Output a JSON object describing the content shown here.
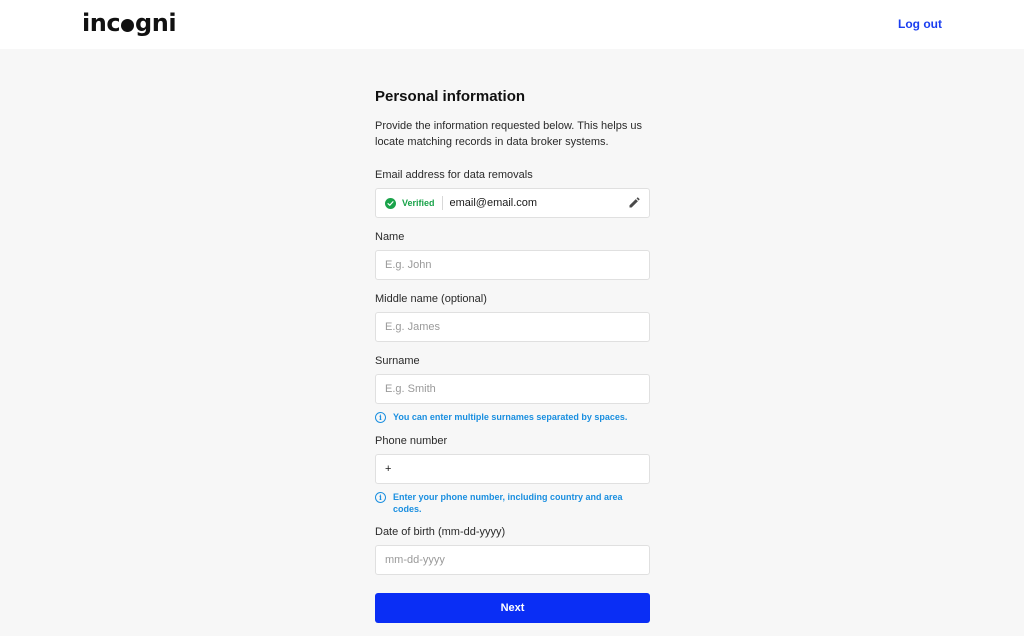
{
  "header": {
    "logo_text_pre": "inc",
    "logo_text_post": "gni",
    "logout_label": "Log out"
  },
  "form": {
    "title": "Personal information",
    "description": "Provide the information requested below. This helps us locate matching records in data broker systems.",
    "email": {
      "label": "Email address for data removals",
      "verified_label": "Verified",
      "value": "email@email.com"
    },
    "name": {
      "label": "Name",
      "placeholder": "E.g. John"
    },
    "middle_name": {
      "label": "Middle name (optional)",
      "placeholder": "E.g. James"
    },
    "surname": {
      "label": "Surname",
      "placeholder": "E.g. Smith",
      "hint": "You can enter multiple surnames separated by spaces."
    },
    "phone": {
      "label": "Phone number",
      "value": "+",
      "hint": "Enter your phone number, including country and area codes."
    },
    "dob": {
      "label": "Date of birth (mm-dd-yyyy)",
      "placeholder": "mm-dd-yyyy"
    },
    "next_label": "Next"
  },
  "colors": {
    "accent": "#0a2ef5",
    "link": "#1a3ef0",
    "verified": "#1aa34a",
    "hint": "#1a8fe0",
    "background": "#f7f7f7"
  },
  "icons": {
    "verified": "check-circle-icon",
    "edit": "pencil-icon",
    "hint": "info-icon"
  }
}
